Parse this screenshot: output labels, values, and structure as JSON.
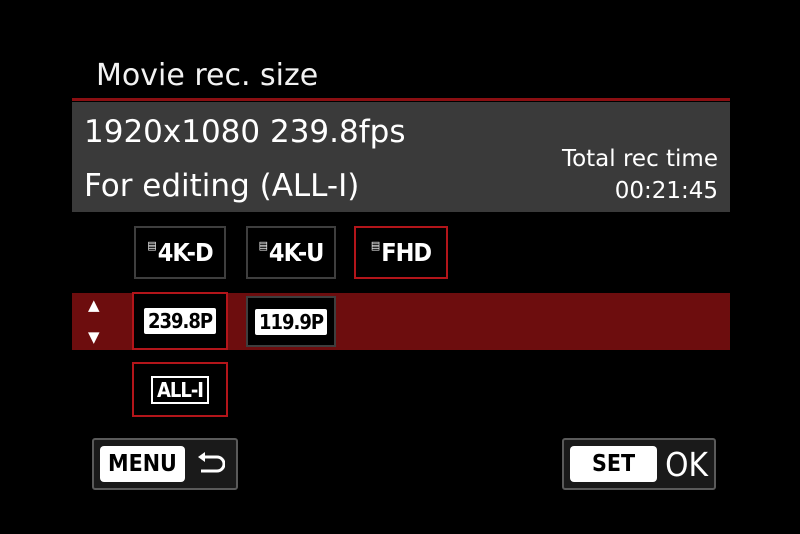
{
  "header": {
    "title": "Movie rec. size"
  },
  "info": {
    "size_line": "1920x1080 239.8fps",
    "mode_line": "For editing (ALL-I)",
    "rec_time_label": "Total rec time",
    "rec_time_value": "00:21:45"
  },
  "resolution_options": [
    {
      "film": "▤",
      "label": "4K-D",
      "selected": false
    },
    {
      "film": "▤",
      "label": "4K-U",
      "selected": false
    },
    {
      "film": "▤",
      "label": "FHD",
      "selected": true
    }
  ],
  "frame_rate_options": [
    {
      "label": "239.8P",
      "selected": true
    },
    {
      "label": "119.9P",
      "selected": false
    }
  ],
  "compression_options": [
    {
      "label": "ALL-I",
      "selected": true
    }
  ],
  "scroll": {
    "up": "▲",
    "down": "▼"
  },
  "buttons": {
    "menu": "MENU",
    "set": "SET",
    "ok": "OK"
  },
  "colors": {
    "accent_red": "#b3151a",
    "row_highlight": "#6d0d0e",
    "panel_gray": "#3a3a3a"
  },
  "icons": [
    "return-arrow-icon",
    "film-strip-icon",
    "arrow-up-icon",
    "arrow-down-icon"
  ]
}
